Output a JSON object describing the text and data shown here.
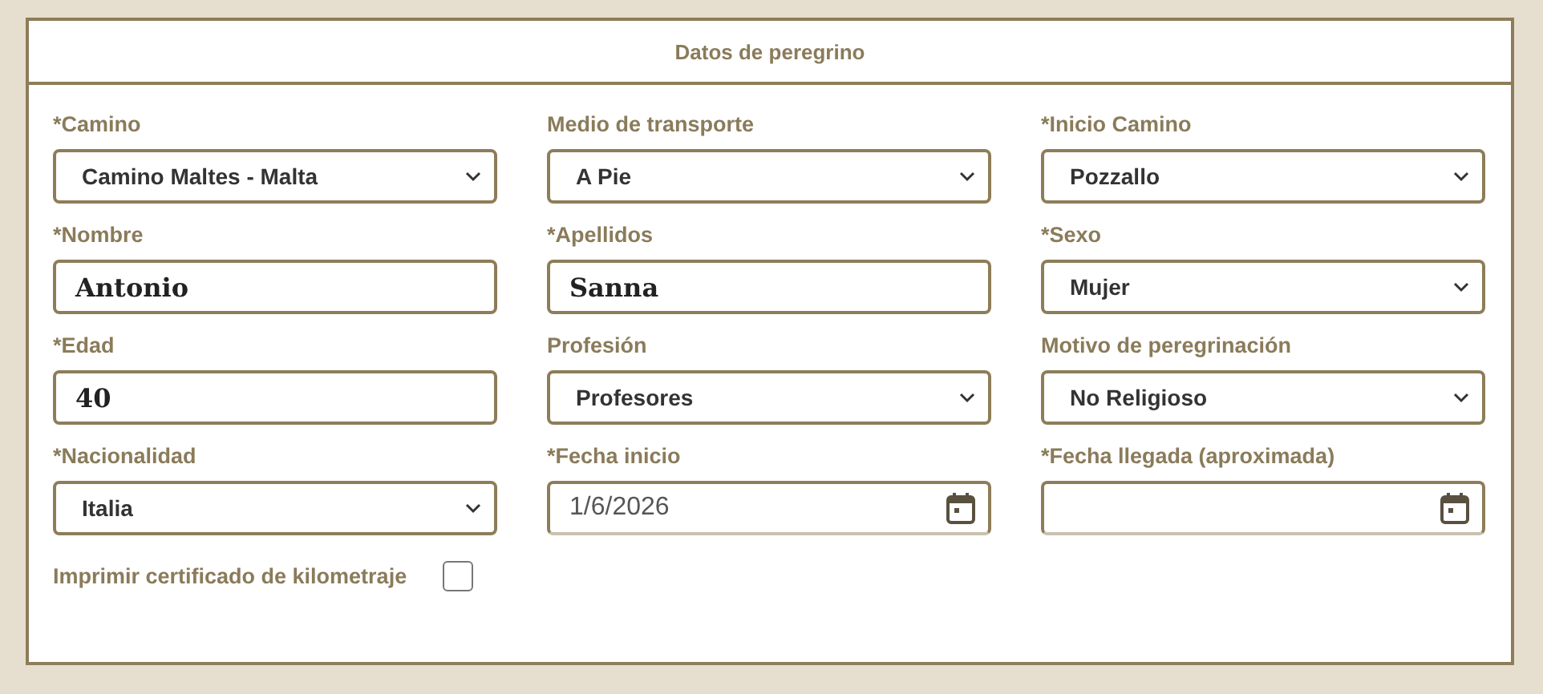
{
  "panel": {
    "title": "Datos de peregrino"
  },
  "fields": [
    {
      "label": "*Camino",
      "kind": "select",
      "value": "Camino Maltes - Malta"
    },
    {
      "label": "Medio de transporte",
      "kind": "select",
      "value": "A Pie"
    },
    {
      "label": "*Inicio Camino",
      "kind": "select",
      "value": "Pozzallo"
    },
    {
      "label": "*Nombre",
      "kind": "text",
      "value": "Antonio"
    },
    {
      "label": "*Apellidos",
      "kind": "text",
      "value": "Sanna"
    },
    {
      "label": "*Sexo",
      "kind": "select",
      "value": "Mujer"
    },
    {
      "label": "*Edad",
      "kind": "text",
      "value": "40"
    },
    {
      "label": "Profesión",
      "kind": "select",
      "value": "Profesores"
    },
    {
      "label": "Motivo de peregrinación",
      "kind": "select",
      "value": "No Religioso"
    },
    {
      "label": "*Nacionalidad",
      "kind": "select",
      "value": "Italia"
    },
    {
      "label": "*Fecha inicio",
      "kind": "date",
      "value": "1/6/2026"
    },
    {
      "label": "*Fecha llegada (aproximada)",
      "kind": "date"
    }
  ],
  "certificate": {
    "label": "Imprimir certificado de kilometraje",
    "checked": false
  }
}
